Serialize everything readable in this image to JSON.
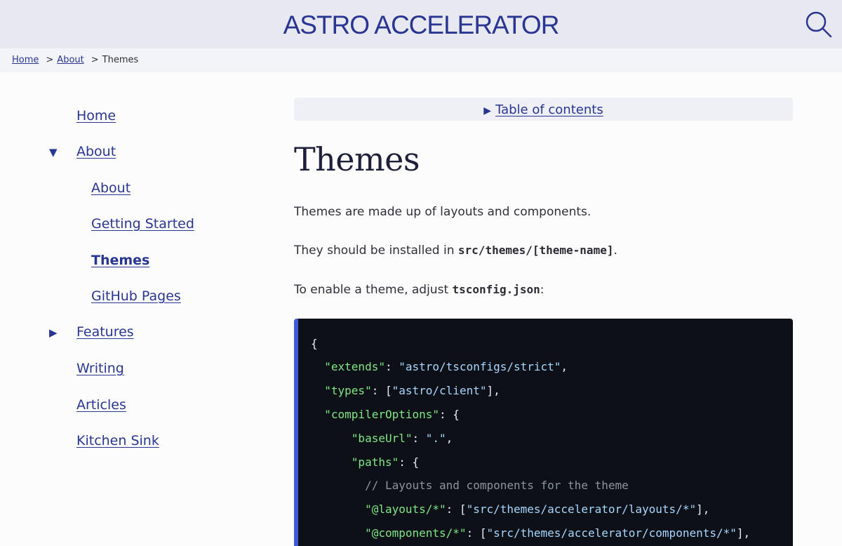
{
  "header": {
    "site_title": "ASTRO ACCELERATOR",
    "search_icon": "search-icon"
  },
  "breadcrumb": {
    "items": [
      "Home",
      "About"
    ],
    "separator": ">",
    "current": "Themes"
  },
  "sidebar": {
    "items": [
      {
        "label": "Home",
        "level": 0
      },
      {
        "label": "About",
        "level": 0,
        "toggle": "expanded"
      },
      {
        "label": "About",
        "level": 1
      },
      {
        "label": "Getting Started",
        "level": 1
      },
      {
        "label": "Themes",
        "level": 1,
        "current": true
      },
      {
        "label": "GitHub Pages",
        "level": 1
      },
      {
        "label": "Features",
        "level": 0,
        "toggle": "collapsed"
      },
      {
        "label": "Writing",
        "level": 0
      },
      {
        "label": "Articles",
        "level": 0
      },
      {
        "label": "Kitchen Sink",
        "level": 0
      }
    ],
    "toggle_expanded_glyph": "▼",
    "toggle_collapsed_glyph": "▶"
  },
  "toc": {
    "glyph": "▶",
    "label": "Table of contents"
  },
  "main": {
    "title": "Themes",
    "p1": "Themes are made up of layouts and components.",
    "p2_text": "They should be installed in ",
    "p2_code": "src/themes/[theme-name]",
    "p2_end": ".",
    "p3_text": "To enable a theme, adjust ",
    "p3_code": "tsconfig.json",
    "p3_end": ":"
  },
  "code": {
    "l1": "{",
    "l2_key": "\"extends\"",
    "l2_val": "\"astro/tsconfigs/strict\"",
    "l3_key": "\"types\"",
    "l3_val": "\"astro/client\"",
    "l4_key": "\"compilerOptions\"",
    "l5_key": "\"baseUrl\"",
    "l5_val": "\".\"",
    "l6_key": "\"paths\"",
    "l7_comment": "// Layouts and components for the theme",
    "l8_key": "\"@layouts/*\"",
    "l8_val": "\"src/themes/accelerator/layouts/*\"",
    "l9_key": "\"@components/*\"",
    "l9_val": "\"src/themes/accelerator/components/*\""
  },
  "colors": {
    "accent": "#283592",
    "code_bg": "#0d1117",
    "code_border": "#3b5bdb",
    "code_key": "#7ee787",
    "code_string": "#a5d6ff"
  }
}
